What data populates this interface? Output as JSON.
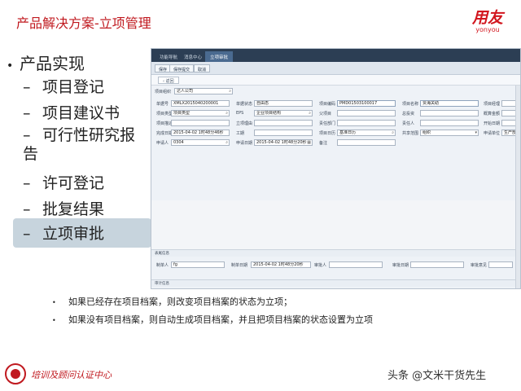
{
  "slide": {
    "title": "产品解决方案-立项管理",
    "brand_main": "用友",
    "brand_sub": "yonyou"
  },
  "outline": {
    "heading": "产品实现",
    "items": [
      {
        "label": "项目登记"
      },
      {
        "label": "项目建议书"
      },
      {
        "label": "可行性研究报告"
      },
      {
        "label": "许可登记"
      },
      {
        "label": "批复结果"
      },
      {
        "label": "立项审批"
      }
    ],
    "highlight_color": "#c7d4dd"
  },
  "app": {
    "tabs": [
      {
        "label": "功能导航"
      },
      {
        "label": "消息中心"
      },
      {
        "label": "立项审批"
      }
    ],
    "toolbar": {
      "save": "保存",
      "save_submit": "保存提交",
      "cancel": "取消"
    },
    "nav": {
      "back": "返回"
    },
    "org": {
      "label": "项目组织",
      "value": "达人公司"
    },
    "fields": {
      "doc_no": {
        "label": "单据号",
        "value": "XMLX2015040200001"
      },
      "doc_status": {
        "label": "单据状态",
        "value": "自由态"
      },
      "project_code": {
        "label": "项目编码",
        "value": "PMD01503100017"
      },
      "project_name": {
        "label": "项目名称",
        "value": "贾海关助"
      },
      "project_manager": {
        "label": "项目经理"
      },
      "project_type": {
        "label": "项目类型",
        "value": "项目类型"
      },
      "eps": {
        "label": "EPS",
        "value": "企业项目结构"
      },
      "parent_project": {
        "label": "父项目"
      },
      "investment": {
        "label": "总投资"
      },
      "budget": {
        "label": "概算金额"
      },
      "project_desc": {
        "label": "项目描述"
      },
      "approval_reason": {
        "label": "立项理由"
      },
      "dept": {
        "label": "责任部门"
      },
      "responsible": {
        "label": "责任人"
      },
      "start_date": {
        "label": "开始日期"
      },
      "finish_date": {
        "label": "完成日期",
        "value": "2015-04-02 1时48分46秒"
      },
      "period": {
        "label": "工期"
      },
      "calendar": {
        "label": "项目日历",
        "value": "基准日历"
      },
      "share_scope": {
        "label": "共享范围",
        "value": "组织"
      },
      "unit": {
        "label": "申请单位",
        "value": "生产部"
      },
      "applicant": {
        "label": "申请人",
        "value": "0304"
      },
      "apply_date": {
        "label": "申请日期",
        "value": "2015-04-02 1时48分20秒"
      },
      "remark": {
        "label": "备注"
      }
    },
    "sections": {
      "table_info": "表尾信息",
      "audit_info": "审计信息"
    },
    "footer": {
      "creator_label": "制单人",
      "creator_value": "fg",
      "create_date_label": "制单日期",
      "create_date_value": "2015-04-02 1时48分20秒",
      "approver_label": "审批人",
      "approve_date_label": "审批日期",
      "approve_comment_label": "审批意见"
    }
  },
  "notes": [
    {
      "text": "如果已经存在项目档案，则改变项目档案的状态为立项；"
    },
    {
      "text": "如果没有项目档案，则自动生成项目档案，并且把项目档案的状态设置为立项"
    }
  ],
  "bottom_logo": {
    "text": "培训及顾问认证中心"
  },
  "watermark": {
    "text": "头条 @文米干货先生"
  }
}
